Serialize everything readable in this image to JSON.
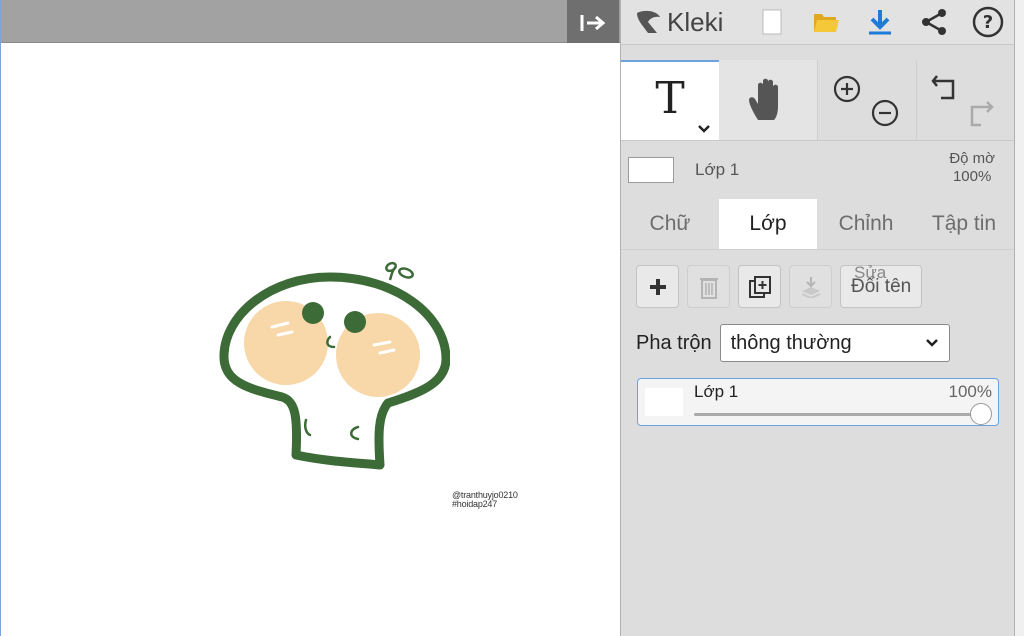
{
  "app": {
    "logo_text": "Kleki"
  },
  "canvas": {
    "watermark_line1": "@tranthuyjo0210",
    "watermark_line2": "#hoidap247"
  },
  "panel": {
    "layer_preview_name": "Lớp 1",
    "opacity_label": "Độ mờ",
    "opacity_value": "100%",
    "tabs": [
      {
        "label": "Chữ",
        "active": false
      },
      {
        "label": "Lớp",
        "active": true
      },
      {
        "label": "Chỉnh",
        "active": false
      },
      {
        "label": "Tập tin",
        "active": false
      }
    ],
    "rename_overlay": "Sửa",
    "rename_label": "Đổi tên",
    "blend_label": "Pha trộn",
    "blend_value": "thông thường",
    "layer_item": {
      "name": "Lớp 1",
      "opacity_text": "100%",
      "opacity": 1.0
    }
  },
  "colors": {
    "accent_blue": "#1e7bd6",
    "folder_yellow": "#f2c230",
    "outline_green": "#3d6b37",
    "cheek_peach": "#f8d7a8"
  },
  "icons": [
    "collapse-panel-icon",
    "kleki-logo-icon",
    "new-file-icon",
    "open-folder-icon",
    "download-icon",
    "share-icon",
    "help-icon",
    "chevron-down-icon",
    "hand-icon",
    "zoom-in-icon",
    "zoom-out-icon",
    "undo-icon",
    "redo-icon",
    "add-layer-icon",
    "delete-layer-icon",
    "duplicate-layer-icon",
    "merge-down-icon"
  ]
}
